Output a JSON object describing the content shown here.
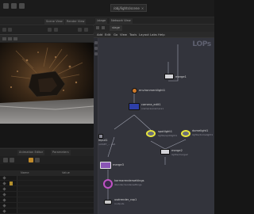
{
  "window": {
    "top_tab_label": "/obj/lights/scene",
    "top_tab_close": "×"
  },
  "viewer": {
    "tabs": [
      "Scene View",
      "Render View",
      "Composite"
    ],
    "background_note": ""
  },
  "params": {
    "tabs": [
      "Animation Editor",
      "Parameters"
    ],
    "columns": [
      "Name",
      "Value"
    ],
    "row_count": 7
  },
  "network": {
    "tabs": [
      "/stage",
      "Network View"
    ],
    "path": "stage",
    "menu": [
      "Add",
      "Edit",
      "Go",
      "View",
      "Tools",
      "Layout",
      "Labs",
      "Help"
    ],
    "watermark": "LOPs",
    "nodes": [
      {
        "id": "merge1",
        "label": "merge1",
        "sub": ""
      },
      {
        "id": "domelight",
        "label": "environmentlight1",
        "sub": ""
      },
      {
        "id": "camera",
        "label": "camera_edit1",
        "sub": "/cameras/camera1"
      },
      {
        "id": "light1",
        "label": "spotlight1",
        "sub": "lights/spotlight1"
      },
      {
        "id": "light2",
        "label": "domelight1",
        "sub": "lights/domelight1"
      },
      {
        "id": "input",
        "label": "input1",
        "sub": "/ASSET_... /GR"
      },
      {
        "id": "merge2",
        "label": "merge2",
        "sub": "lights/merge2"
      },
      {
        "id": "merge3",
        "label": "merge3",
        "sub": ""
      },
      {
        "id": "render",
        "label": "karmarendersettings",
        "sub": "/Render/rendersettings"
      },
      {
        "id": "rop",
        "label": "usdrender_rop1",
        "sub": "/outputs"
      }
    ]
  },
  "colors": {
    "network_bg": "#33343c",
    "node_blue": "#2e3fa8",
    "node_purple": "#8a55b5",
    "node_white": "#d3d3d8",
    "light_ring": "#e7e63c",
    "render_ring": "#c052c4",
    "selection": "#b4902c"
  }
}
